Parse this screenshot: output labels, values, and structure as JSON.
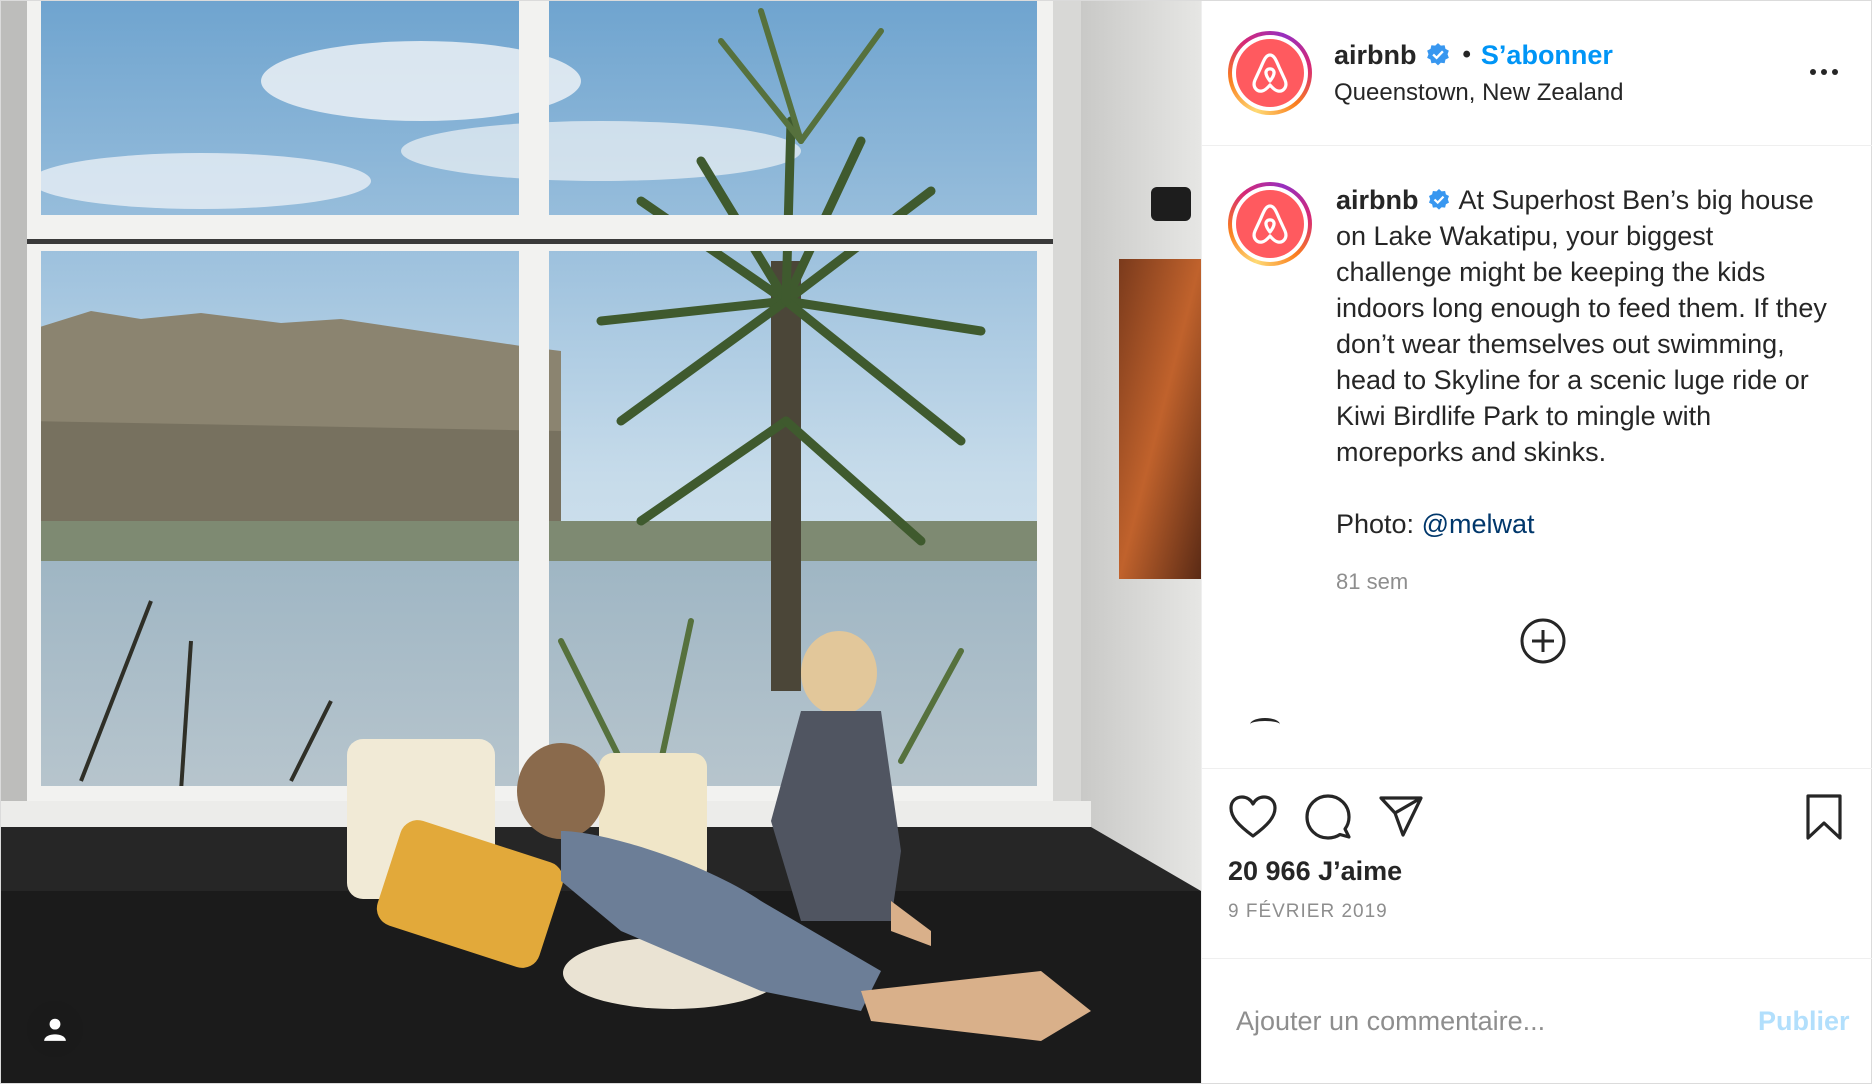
{
  "post": {
    "username": "airbnb",
    "follow_label": "S’abonner",
    "dot": "•",
    "location": "Queenstown, New Zealand",
    "caption": "At Superhost Ben’s big house on Lake Wakatipu, your biggest challenge might be keeping the kids indoors long enough to feed them. If they don’t wear themselves out swimming, head to Skyline for a scenic luge ride or Kiwi Birdlife Park to mingle with moreporks and skinks.",
    "photo_label": "Photo:",
    "photo_mention": "@melwat",
    "time_ago": "81 sem",
    "likes": "20 966 J’aime",
    "date": "9 FÉVRIER 2019"
  },
  "comment": {
    "placeholder": "Ajouter un commentaire...",
    "publish_label": "Publier"
  },
  "icons": {
    "verified": "verified-badge-icon",
    "more": "more-options-icon",
    "tag": "user-tag-icon",
    "like": "heart-icon",
    "comment": "comment-icon",
    "share": "share-icon",
    "save": "bookmark-icon",
    "load_more": "plus-circle-icon"
  },
  "colors": {
    "brand_airbnb": "#ff5a5f",
    "link_blue": "#0095f6",
    "mention": "#00376b",
    "muted": "#8e8e8e",
    "publish_disabled": "#b2dffc"
  }
}
